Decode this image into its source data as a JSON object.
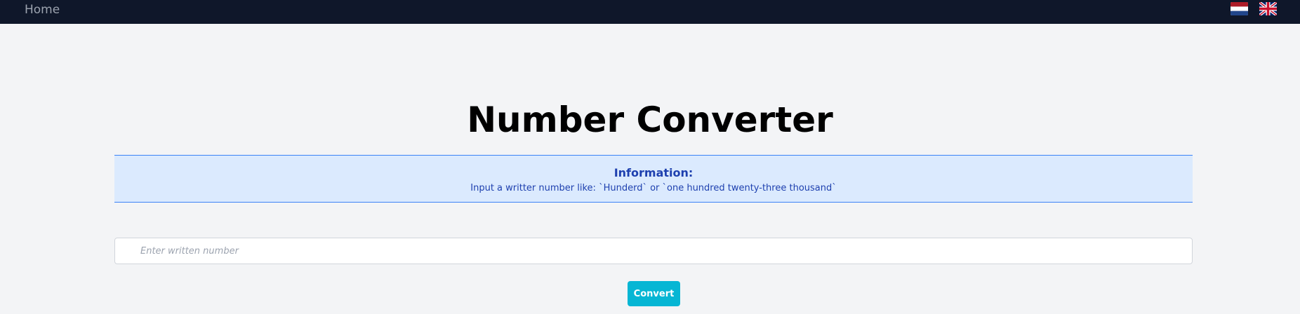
{
  "navbar": {
    "home_label": "Home",
    "languages": [
      {
        "icon": "netherlands-flag-icon",
        "code": "nl"
      },
      {
        "icon": "united-kingdom-flag-icon",
        "code": "en"
      }
    ]
  },
  "main": {
    "title": "Number Converter",
    "info": {
      "title": "Information:",
      "text": "Input a writter number like: `Hunderd` or `one hundred twenty-three thousand`"
    },
    "input": {
      "placeholder": "Enter written number",
      "value": ""
    },
    "convert_label": "Convert"
  },
  "colors": {
    "navbar_bg": "#0f172a",
    "page_bg": "#f3f4f6",
    "info_bg": "#dbeafe",
    "info_border": "#3b82f6",
    "info_text": "#1e40af",
    "button_bg": "#06b6d4"
  }
}
